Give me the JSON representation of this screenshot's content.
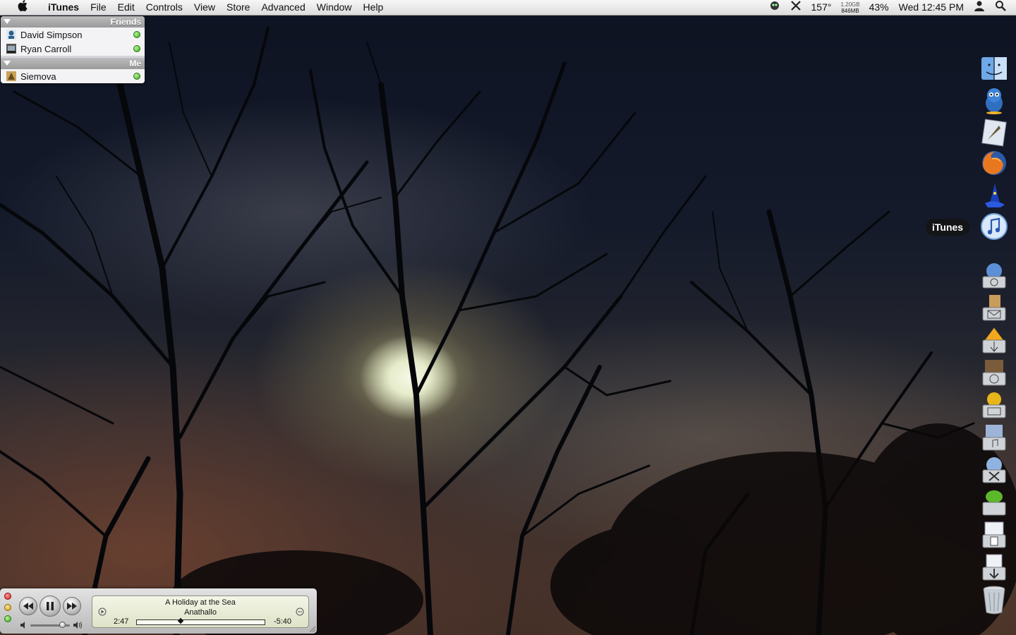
{
  "menubar": {
    "app_name": "iTunes",
    "menus": [
      "File",
      "Edit",
      "Controls",
      "View",
      "Store",
      "Advanced",
      "Window",
      "Help"
    ],
    "status": {
      "temperature": "157°",
      "memory_top": "1.20GB",
      "memory_bottom": "846MB",
      "battery": "43%",
      "clock": "Wed 12:45 PM"
    }
  },
  "buddy_list": {
    "groups": [
      {
        "name": "Friends",
        "buddies": [
          {
            "name": "David Simpson",
            "status": "available"
          },
          {
            "name": "Ryan Carroll",
            "status": "available"
          }
        ]
      },
      {
        "name": "Me",
        "buddies": [
          {
            "name": "Siemova",
            "status": "available"
          }
        ]
      }
    ]
  },
  "mini_player": {
    "track": "A Holiday at the Sea",
    "artist": "Anathallo",
    "elapsed": "2:47",
    "remaining": "-5:40",
    "progress_fraction": 0.34,
    "volume_fraction": 0.8
  },
  "dock": {
    "tooltip": "iTunes",
    "apps": [
      "finder-icon",
      "adium-icon",
      "mail-icon",
      "firefox-icon",
      "wizard-app-icon",
      "itunes-icon"
    ],
    "stacks": [
      "network-stack-icon",
      "mail-stack-icon",
      "system-stack-icon",
      "people-stack-icon",
      "finance-stack-icon",
      "music-stack-icon",
      "web-stack-icon",
      "apps-stack-icon",
      "documents-stack-icon",
      "downloads-stack-icon",
      "trash-icon"
    ]
  },
  "colors": {
    "menubar": "#e6e6e6",
    "status_available": "#3aa31c",
    "lcd": "#e9ecd5"
  }
}
